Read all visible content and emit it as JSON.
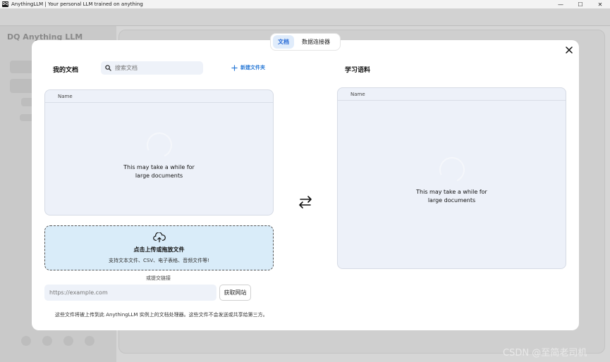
{
  "window": {
    "title": "AnythingLLM | Your personal LLM trained on anything",
    "icon_text": "DQ",
    "controls": [
      "—",
      "☐",
      "✕"
    ]
  },
  "background_app": {
    "logo": "DQ Anything LLM"
  },
  "modal": {
    "tabs": [
      {
        "label": "文档",
        "active": true
      },
      {
        "label": "数据连接器",
        "active": false
      }
    ],
    "left_panel": {
      "title": "我的文档",
      "search_placeholder": "搜索文档",
      "new_folder_label": "新建文件夹",
      "column_header": "Name",
      "loading_text": "This may take a while for large documents"
    },
    "upload": {
      "title": "点击上传或拖放文件",
      "subtitle": "支持文本文件、CSV、电子表格、音频文件等!"
    },
    "or_text": "或提交链接",
    "url_placeholder": "https://example.com",
    "fetch_button": "获取网站",
    "footnote": "这些文件将被上传到此 AnythingLLM 实例上的文档处理器。这些文件不会发送或共享给第三方。",
    "right_panel": {
      "title": "学习语料",
      "column_header": "Name",
      "loading_text": "This may take a while for large documents"
    }
  },
  "watermark": "CSDN @至简老司机",
  "colors": {
    "accent": "#2a7ad6",
    "panel_bg": "#edf1f9",
    "upload_bg": "#d9ecf9",
    "overlay": "#d6d6d6"
  }
}
